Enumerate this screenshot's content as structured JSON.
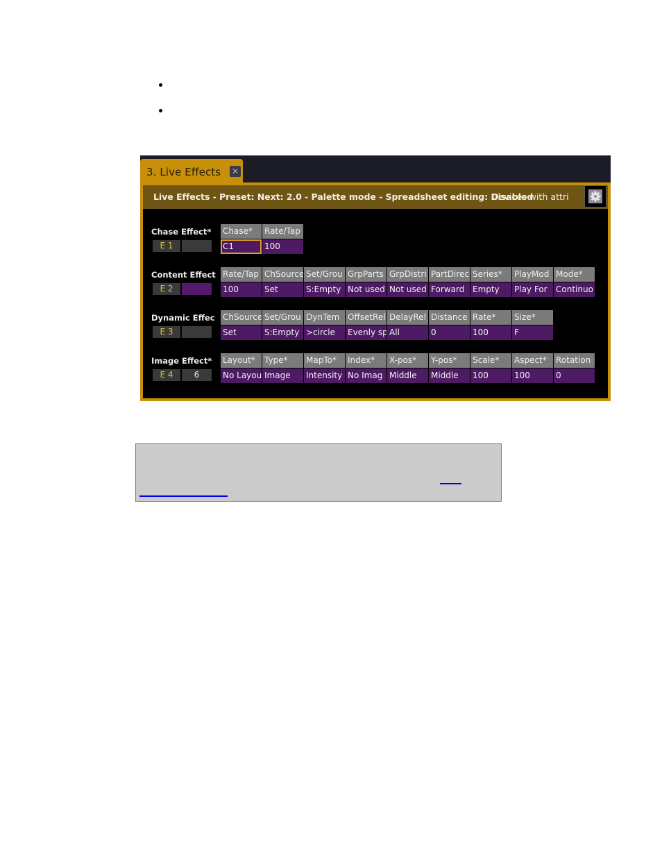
{
  "document": {
    "bullets": [
      "",
      ""
    ],
    "note": {
      "text": "",
      "link_text": ""
    }
  },
  "window": {
    "tab_label": "3. Live Effects",
    "tab_close_icon": "close-icon",
    "header_text": "Live Effects - Preset:  Next: 2.0 - Palette mode - Spreadsheet editing: Disabled",
    "header_overlay_text": "Devices with attri",
    "settings_icon": "gear-icon",
    "colors": {
      "accent": "#c8900a",
      "header_bg": "#6f5514",
      "column_header_bg": "#7b7b7b",
      "value_bg": "#4d1a63",
      "effect_id_text": "#d8c13a",
      "selected_border": "#e0a020"
    }
  },
  "effects": [
    {
      "title": "Chase Effect*",
      "id": "E 1",
      "extra": "",
      "columns": [
        {
          "header": "Chase*",
          "value": "C1",
          "selected": true
        },
        {
          "header": "Rate/Tap",
          "value": "100"
        }
      ]
    },
    {
      "title": "Content Effect",
      "id": "E 2",
      "extra": "",
      "columns": [
        {
          "header": "Rate/Tap",
          "value": "100"
        },
        {
          "header": "ChSource",
          "value": "Set"
        },
        {
          "header": "Set/Grou",
          "value": "S:Empty"
        },
        {
          "header": "GrpParts",
          "value": "Not used"
        },
        {
          "header": "GrpDistri",
          "value": "Not used"
        },
        {
          "header": "PartDirec",
          "value": "Forward"
        },
        {
          "header": "Series*",
          "value": "Empty"
        },
        {
          "header": "PlayMod",
          "value": "Play For"
        },
        {
          "header": "Mode*",
          "value": "Continuo"
        }
      ]
    },
    {
      "title": "Dynamic Effec",
      "id": "E 3",
      "extra": "",
      "columns": [
        {
          "header": "ChSource",
          "value": "Set"
        },
        {
          "header": "Set/Grou",
          "value": "S:Empty"
        },
        {
          "header": "DynTem",
          "value": ">circle"
        },
        {
          "header": "OffsetRel",
          "value": "Evenly sp"
        },
        {
          "header": "DelayRel",
          "value": "All"
        },
        {
          "header": "Distance",
          "value": "0"
        },
        {
          "header": "Rate*",
          "value": "100"
        },
        {
          "header": "Size*",
          "value": "F"
        }
      ]
    },
    {
      "title": "Image Effect*",
      "id": "E 4",
      "extra": "6",
      "columns": [
        {
          "header": "Layout*",
          "value": "No Layou"
        },
        {
          "header": "Type*",
          "value": "Image"
        },
        {
          "header": "MapTo*",
          "value": "Intensity"
        },
        {
          "header": "Index*",
          "value": "No Imag"
        },
        {
          "header": "X-pos*",
          "value": "Middle"
        },
        {
          "header": "Y-pos*",
          "value": "Middle"
        },
        {
          "header": "Scale*",
          "value": "100"
        },
        {
          "header": "Aspect*",
          "value": "100"
        },
        {
          "header": "Rotation",
          "value": "0"
        }
      ]
    }
  ]
}
